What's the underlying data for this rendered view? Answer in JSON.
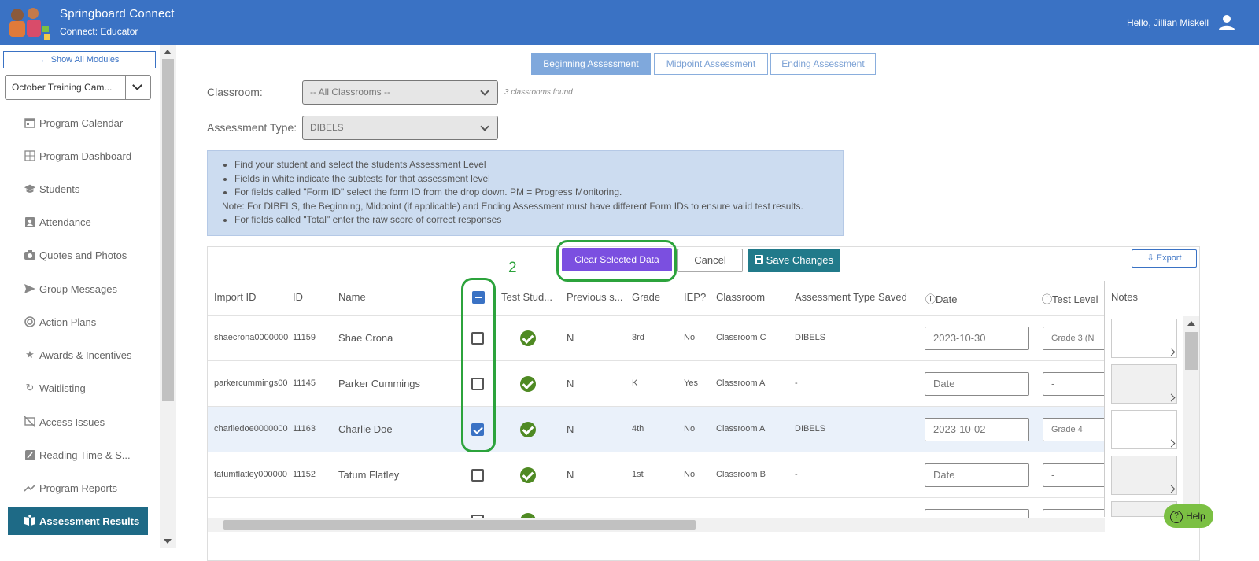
{
  "header": {
    "title": "Springboard Connect",
    "subtitle": "Connect: Educator",
    "greeting": "Hello, Jillian Miskell",
    "brand_color": "#3a72c4"
  },
  "sidebar": {
    "show_all": "Show All Modules",
    "campaign": "October Training Cam...",
    "items": [
      {
        "label": "Program Calendar",
        "icon": "calendar-icon"
      },
      {
        "label": "Program Dashboard",
        "icon": "grid-icon"
      },
      {
        "label": "Students",
        "icon": "graduation-cap-icon"
      },
      {
        "label": "Attendance",
        "icon": "clipboard-user-icon"
      },
      {
        "label": "Quotes and Photos",
        "icon": "camera-icon"
      },
      {
        "label": "Group Messages",
        "icon": "paper-plane-icon"
      },
      {
        "label": "Action Plans",
        "icon": "target-icon"
      },
      {
        "label": "Awards & Incentives",
        "icon": "star-icon"
      },
      {
        "label": "Waitlisting",
        "icon": "refresh-icon"
      },
      {
        "label": "Access Issues",
        "icon": "access-issue-icon"
      },
      {
        "label": "Reading Time & S...",
        "icon": "edit-icon"
      },
      {
        "label": "Program Reports",
        "icon": "chart-line-icon"
      }
    ],
    "active": "Assessment Results"
  },
  "tabs": [
    "Beginning Assessment",
    "Midpoint Assessment",
    "Ending Assessment"
  ],
  "filters": {
    "classroom_label": "Classroom:",
    "classroom_value": "-- All Classrooms --",
    "classrooms_found": "3 classrooms found",
    "type_label": "Assessment Type:",
    "type_value": "DIBELS"
  },
  "info": {
    "b1": "Find your student and select the students Assessment Level",
    "b2": "Fields in white indicate the subtests for that assessment level",
    "b3": "For fields called \"Form ID\" select the form ID from the drop down. PM = Progress Monitoring.",
    "note": "Note: For DIBELS, the Beginning, Midpoint (if applicable) and Ending Assessment must have different Form IDs to ensure valid test results.",
    "b4": "For fields called \"Total\" enter the raw score of correct responses"
  },
  "actions": {
    "clear": "Clear Selected Data",
    "cancel": "Cancel",
    "save": "Save Changes",
    "export": "Export"
  },
  "annotation_number": "2",
  "table": {
    "headers": [
      "Import ID",
      "ID",
      "Name",
      "Test Stud...",
      "Previous s...",
      "Grade",
      "IEP?",
      "Classroom",
      "Assessment Type Saved",
      "Date",
      "Test Level",
      "Notes"
    ],
    "rows": [
      {
        "import_id": "shaecrona0000000",
        "id": "11159",
        "name": "Shae Crona",
        "checked": false,
        "prev": "N",
        "grade": "3rd",
        "iep": "No",
        "classroom": "Classroom C",
        "type": "DIBELS",
        "date": "2023-10-30",
        "level": "Grade 3 (N"
      },
      {
        "import_id": "parkercummings00",
        "id": "11145",
        "name": "Parker Cummings",
        "checked": false,
        "prev": "N",
        "grade": "K",
        "iep": "Yes",
        "classroom": "Classroom A",
        "type": "-",
        "date": "Date",
        "level": "-"
      },
      {
        "import_id": "charliedoe0000000",
        "id": "11163",
        "name": "Charlie Doe",
        "checked": true,
        "prev": "N",
        "grade": "4th",
        "iep": "No",
        "classroom": "Classroom A",
        "type": "DIBELS",
        "date": "2023-10-02",
        "level": "Grade 4"
      },
      {
        "import_id": "tatumflatley000000",
        "id": "11152",
        "name": "Tatum Flatley",
        "checked": false,
        "prev": "N",
        "grade": "1st",
        "iep": "No",
        "classroom": "Classroom B",
        "type": "-",
        "date": "Date",
        "level": "-"
      }
    ]
  },
  "help": "Help"
}
